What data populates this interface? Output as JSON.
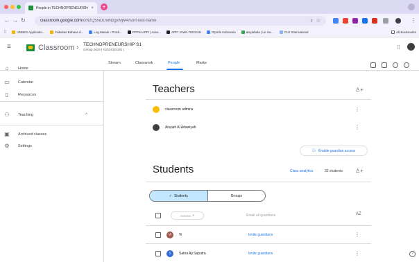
{
  "browser": {
    "tab_title": "People in TECHNOPRENEURSHIP S1",
    "url_host": "classroom.google.com",
    "url_path": "/c/NzQ5NDUwNzgxMjM4/sort-last-name",
    "bookmarks": [
      {
        "label": "UNNES Applicatio...",
        "color": "#f4b400"
      },
      {
        "label": "Fakultas Bahasa d...",
        "color": "#f4b400"
      },
      {
        "label": "Log Masuk › Prodi...",
        "color": "#4285f4"
      },
      {
        "label": "PPPSI APFI | Asso...",
        "color": "#202124"
      },
      {
        "label": "APFI JAWA TENGAH",
        "color": "#202124"
      },
      {
        "label": "IFpmfs Indonesia",
        "color": "#4285f4"
      },
      {
        "label": "aisyiahala | Le mo...",
        "color": "#34a853"
      },
      {
        "label": "CLE International",
        "color": "#8ab4f8"
      }
    ],
    "all_bookmarks_label": "All Bookmarks"
  },
  "header": {
    "brand": "Classroom",
    "class_name": "TECHNOPRENEURSHIP S1",
    "class_sub": "Genap 2024 | K2024320181 |"
  },
  "subnav": {
    "tabs": [
      "Stream",
      "Classwork",
      "People",
      "Marks"
    ],
    "active": "People"
  },
  "sidebar": {
    "home": "Home",
    "calendar": "Calendar",
    "resources": "Resources",
    "teaching": "Teaching",
    "archived": "Archived classes",
    "settings": "Settings"
  },
  "teachers": {
    "title": "Teachers",
    "rows": [
      {
        "name": "classroom admins"
      },
      {
        "name": "Aisyiah Al Adawiyah"
      }
    ]
  },
  "guardian_button": "Enable guardian access",
  "students": {
    "title": "Students",
    "analytics": "Class analytics",
    "count": "32 students",
    "toggle_students": "Students",
    "toggle_groups": "Groups",
    "actions": "Actions",
    "email_all": "Email all guardians",
    "sort_label": "AZ",
    "rows": [
      {
        "initial": "Vi",
        "name": "Vi",
        "invite": "Invite guardians",
        "color": "#a1574e"
      },
      {
        "initial": "S",
        "name": "Satria Aji Saputra",
        "invite": "Invite guardians",
        "color": "#3367d6"
      }
    ]
  },
  "colors": {
    "accent": "#1a73e8",
    "tab_strip": "#dcd9f2",
    "segment_active": "#c2e7ff"
  }
}
